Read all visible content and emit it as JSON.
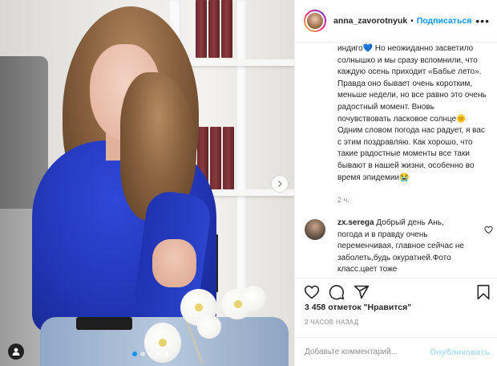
{
  "header": {
    "username": "anna_zavorotnyuk",
    "separator": "•",
    "follow_label": "Подписаться",
    "more_label": "•••"
  },
  "caption": {
    "text_before_emoji1": "индиго",
    "emoji1": "💙",
    "text_after_emoji1": " Но неожиданно засветило солнышко и мы сразу вспомнили, что каждую осень приходит «Бабье лето». Правда оно бывает очень коротким, меньше недели, но все равно это очень радостный момент. Вновь почувствовать ласковое солнце",
    "emoji2": "🌞",
    "text_after_emoji2": " Одним словом погода нас радует, я вас с этим поздравляю. Как хорошо, что такие радостные моменты все таки бывают в нашей жизни, особенно во время эпидемии",
    "emoji3": "😭",
    "time": "2 ч."
  },
  "comment": {
    "username": "zx.serega",
    "text": " Добрый день Ань, погода и в правду очень переменчивая, главное сейчас не заболеть,будь окуратней.Фото класс.цвет тоже"
  },
  "stats": {
    "likes": "3 458 отметок \"Нравится\"",
    "date": "2 ЧАСОВ НАЗАД"
  },
  "add_comment": {
    "placeholder": "Добавьте комментарий...",
    "publish_label": "Опубликовать"
  },
  "icons": {
    "like": "heart-icon",
    "comment": "comment-icon",
    "share": "share-icon",
    "save": "bookmark-icon",
    "next": "chevron-right-icon",
    "user_tag": "user-tag-icon",
    "comment_like": "heart-small-icon"
  },
  "colors": {
    "accent": "#0095f6",
    "publish_disabled": "#b2dffc",
    "secondary_text": "#8e8e8e"
  },
  "carousel": {
    "slide_count": 5,
    "active_index": 0
  }
}
